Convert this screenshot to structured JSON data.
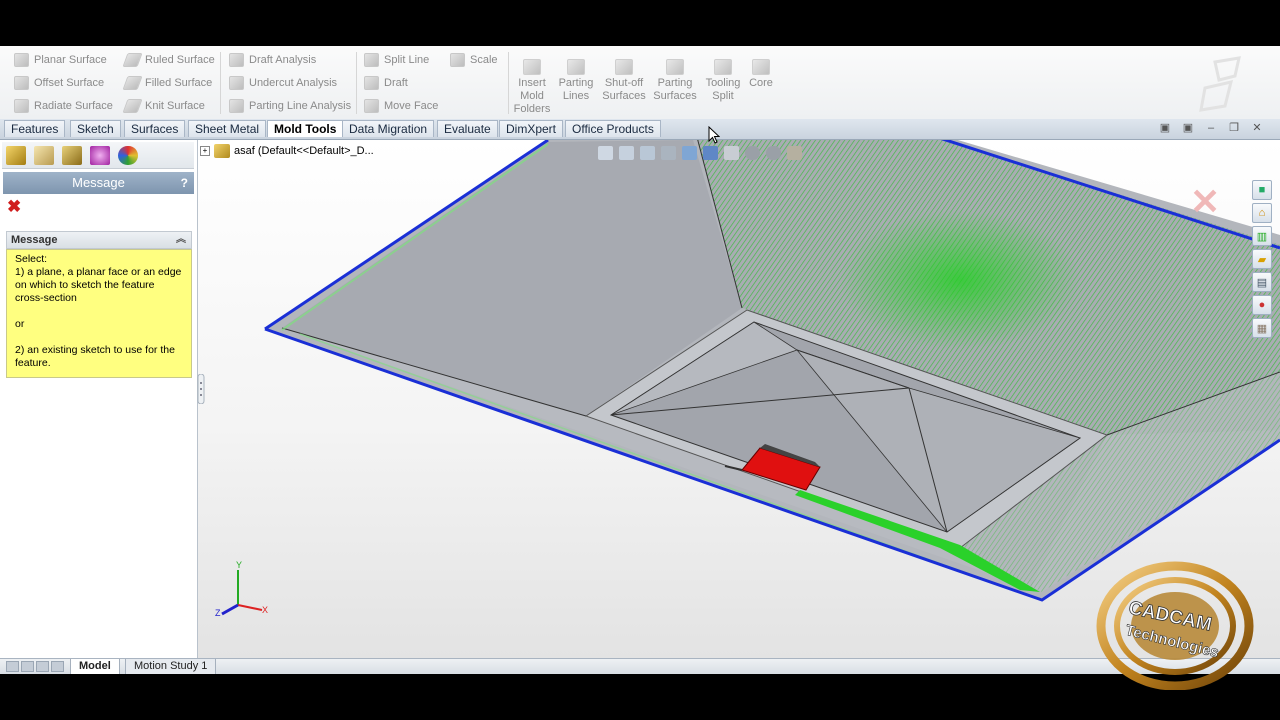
{
  "ribbon": {
    "col1": [
      "Planar Surface",
      "Offset Surface",
      "Radiate Surface"
    ],
    "col2": [
      "Ruled Surface",
      "Filled Surface",
      "Knit Surface"
    ],
    "col3": [
      "Draft Analysis",
      "Undercut Analysis",
      "Parting Line Analysis"
    ],
    "col4": [
      "Split Line",
      "Draft",
      "Move Face"
    ],
    "col5": [
      "Scale"
    ],
    "big": [
      {
        "line1": "Insert",
        "line2": "Mold",
        "line3": "Folders"
      },
      {
        "line1": "Parting",
        "line2": "Lines",
        "line3": ""
      },
      {
        "line1": "Shut-off",
        "line2": "Surfaces",
        "line3": ""
      },
      {
        "line1": "Parting",
        "line2": "Surfaces",
        "line3": ""
      },
      {
        "line1": "Tooling",
        "line2": "Split",
        "line3": ""
      },
      {
        "line1": "Core",
        "line2": "",
        "line3": ""
      }
    ]
  },
  "tabs": [
    "Features",
    "Sketch",
    "Surfaces",
    "Sheet Metal",
    "Mold Tools",
    "Data Migration",
    "Evaluate",
    "DimXpert",
    "Office Products"
  ],
  "active_tab": "Mold Tools",
  "property_manager": {
    "title": "Message",
    "help": "?",
    "section_title": "Message",
    "message": {
      "line1": "Select:",
      "line2": "1) a plane, a planar face or an edge on which to sketch the feature cross-section",
      "line3": "or",
      "line4": "2) an existing sketch to use for the feature."
    }
  },
  "tree": {
    "part_name": "asaf  (Default<<Default>_D..."
  },
  "bottom_tabs": [
    "Model",
    "Motion Study 1"
  ],
  "logo": {
    "line1": "CADCAM",
    "line2": "Technologies"
  },
  "colors": {
    "accent_blue": "#1a2fd6",
    "selection_green": "#2ad12a",
    "highlight_red": "#e01010",
    "message_yellow": "#ffff80"
  }
}
